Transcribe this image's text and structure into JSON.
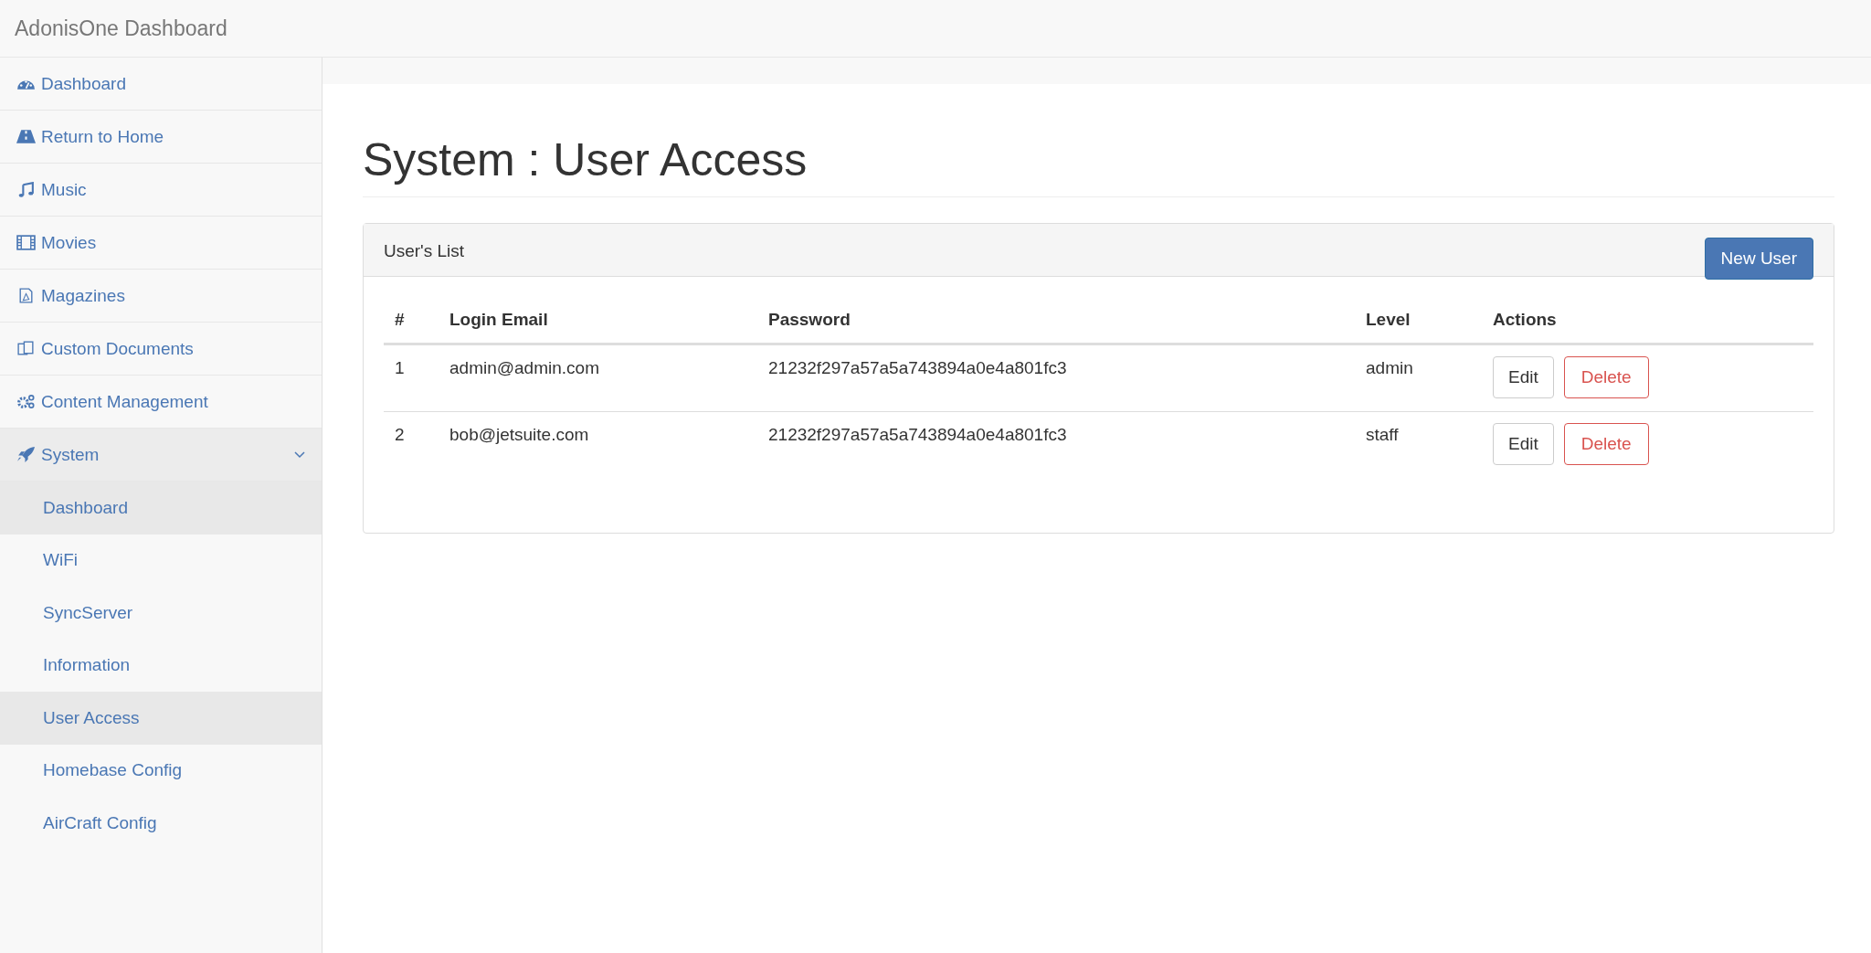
{
  "navbar": {
    "brand": "AdonisOne Dashboard"
  },
  "sidebar": {
    "items": [
      {
        "label": "Dashboard",
        "kind": "gauge"
      },
      {
        "label": "Return to Home",
        "kind": "road"
      },
      {
        "label": "Music",
        "kind": "music"
      },
      {
        "label": "Movies",
        "kind": "film"
      },
      {
        "label": "Magazines",
        "kind": "pdf"
      },
      {
        "label": "Custom Documents",
        "kind": "files"
      },
      {
        "label": "Content Management",
        "kind": "gears"
      },
      {
        "label": "System",
        "kind": "rocket",
        "expanded": true,
        "children": [
          {
            "label": "Dashboard",
            "selected": true
          },
          {
            "label": "WiFi",
            "selected": false
          },
          {
            "label": "SyncServer",
            "selected": false
          },
          {
            "label": "Information",
            "selected": false
          },
          {
            "label": "User Access",
            "selected": true
          },
          {
            "label": "Homebase Config",
            "selected": false
          },
          {
            "label": "AirCraft Config",
            "selected": false
          }
        ]
      }
    ]
  },
  "page": {
    "title": "System : User Access"
  },
  "panel": {
    "title": "User's List",
    "new_button": "New User",
    "table": {
      "columns": [
        "#",
        "Login Email",
        "Password",
        "Level",
        "Actions"
      ],
      "rows": [
        {
          "cells": [
            "1",
            "admin@admin.com",
            "21232f297a57a5a743894a0e4a801fc3",
            "admin"
          ],
          "actions": [
            "Edit",
            "Delete"
          ]
        },
        {
          "cells": [
            "2",
            "bob@jetsuite.com",
            "21232f297a57a5a743894a0e4a801fc3",
            "staff"
          ],
          "actions": [
            "Edit",
            "Delete"
          ]
        }
      ]
    }
  }
}
